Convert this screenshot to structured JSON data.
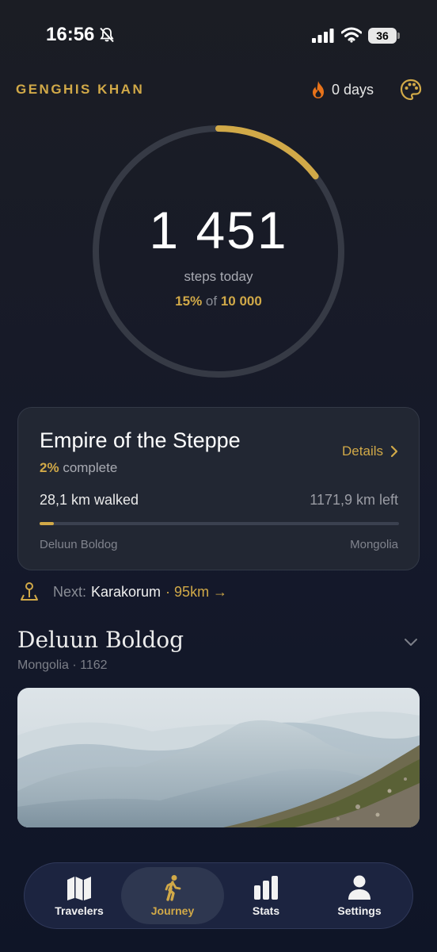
{
  "status_bar": {
    "time": "16:56",
    "battery": "36",
    "icons": [
      "mute-icon",
      "signal-icon",
      "wifi-icon",
      "battery-icon"
    ]
  },
  "header": {
    "traveler_name": "GENGHIS KHAN",
    "streak_label": "0 days",
    "streak_icon": "flame-icon",
    "theme_icon": "palette-icon"
  },
  "steps": {
    "count": "1 451",
    "label": "steps today",
    "percent": "15%",
    "of": "of",
    "goal": "10 000",
    "progress": 0.1451
  },
  "journey": {
    "title": "Empire of the Steppe",
    "complete_percent": "2%",
    "complete_text": "complete",
    "details_label": "Details",
    "walked": "28,1 km walked",
    "left": "1171,9 km left",
    "progress": 0.02,
    "from": "Deluun Boldog",
    "to": "Mongolia"
  },
  "next": {
    "label": "Next:",
    "place": "Karakorum",
    "distance": "· 95km →"
  },
  "location": {
    "name": "Deluun Boldog",
    "meta": "Mongolia · 1162"
  },
  "tabs": [
    {
      "label": "Travelers",
      "icon": "map-icon",
      "active": false
    },
    {
      "label": "Journey",
      "icon": "walking-icon",
      "active": true
    },
    {
      "label": "Stats",
      "icon": "bar-chart-icon",
      "active": false
    },
    {
      "label": "Settings",
      "icon": "person-icon",
      "active": false
    }
  ],
  "colors": {
    "accent": "#d1a948",
    "background": "#15192a",
    "card": "#222733",
    "ring_track": "#363a45",
    "flame": "#e8731a"
  }
}
